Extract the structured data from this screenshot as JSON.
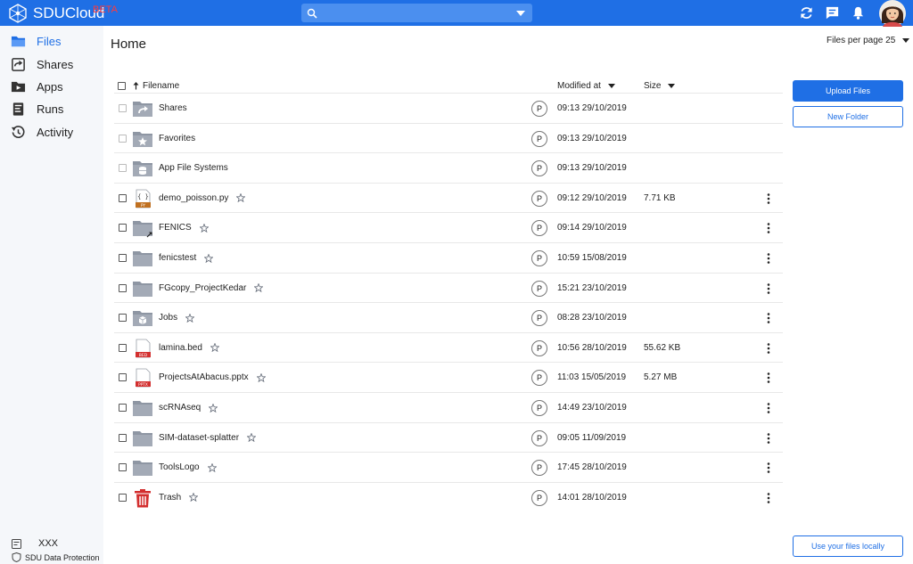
{
  "brand": {
    "name": "SDUCloud",
    "badge": "BETA"
  },
  "search": {
    "placeholder": ""
  },
  "sidebar": {
    "items": [
      {
        "label": "Files",
        "icon": "folder-icon",
        "active": true
      },
      {
        "label": "Shares",
        "icon": "share-icon"
      },
      {
        "label": "Apps",
        "icon": "apps-icon"
      },
      {
        "label": "Runs",
        "icon": "runs-icon"
      },
      {
        "label": "Activity",
        "icon": "activity-icon"
      }
    ],
    "footer": {
      "user": "XXX",
      "data_protection": "SDU Data Protection"
    }
  },
  "main": {
    "title": "Home",
    "per_page_label": "Files per page 25",
    "columns": {
      "filename": "Filename",
      "modified": "Modified at",
      "size": "Size"
    },
    "rows": [
      {
        "name": "Shares",
        "icon": "shared-folder-icon",
        "perm": "P",
        "modified": "09:13 29/10/2019",
        "size": ""
      },
      {
        "name": "Favorites",
        "icon": "favorites-folder-icon",
        "perm": "P",
        "modified": "09:13 29/10/2019",
        "size": ""
      },
      {
        "name": "App File Systems",
        "icon": "filesystem-folder-icon",
        "perm": "P",
        "modified": "09:13 29/10/2019",
        "size": ""
      },
      {
        "name": "demo_poisson.py",
        "icon": "python-file-icon",
        "perm": "P",
        "modified": "09:12 29/10/2019",
        "size": "7.71 KB"
      },
      {
        "name": "FENICS",
        "icon": "link-folder-icon",
        "perm": "P",
        "modified": "09:14 29/10/2019",
        "size": ""
      },
      {
        "name": "fenicstest",
        "icon": "folder-icon",
        "perm": "P",
        "modified": "10:59 15/08/2019",
        "size": ""
      },
      {
        "name": "FGcopy_ProjectKedar",
        "icon": "folder-icon",
        "perm": "P",
        "modified": "15:21 23/10/2019",
        "size": ""
      },
      {
        "name": "Jobs",
        "icon": "jobs-folder-icon",
        "perm": "P",
        "modified": "08:28 23/10/2019",
        "size": ""
      },
      {
        "name": "lamina.bed",
        "icon": "bed-file-icon",
        "perm": "P",
        "modified": "10:56 28/10/2019",
        "size": "55.62 KB"
      },
      {
        "name": "ProjectsAtAbacus.pptx",
        "icon": "pptx-file-icon",
        "perm": "P",
        "modified": "11:03 15/05/2019",
        "size": "5.27 MB"
      },
      {
        "name": "scRNAseq",
        "icon": "folder-icon",
        "perm": "P",
        "modified": "14:49 23/10/2019",
        "size": ""
      },
      {
        "name": "SIM-dataset-splatter",
        "icon": "folder-icon",
        "perm": "P",
        "modified": "09:05 11/09/2019",
        "size": ""
      },
      {
        "name": "ToolsLogo",
        "icon": "folder-icon",
        "perm": "P",
        "modified": "17:45 28/10/2019",
        "size": ""
      },
      {
        "name": "Trash",
        "icon": "trash-icon",
        "perm": "P",
        "modified": "14:01 28/10/2019",
        "size": ""
      }
    ]
  },
  "actions": {
    "upload": "Upload Files",
    "new_folder": "New Folder",
    "local": "Use your files locally"
  },
  "colors": {
    "primary": "#1f6fe5",
    "folder": "#8e96a3",
    "trash": "#d32f2f"
  }
}
